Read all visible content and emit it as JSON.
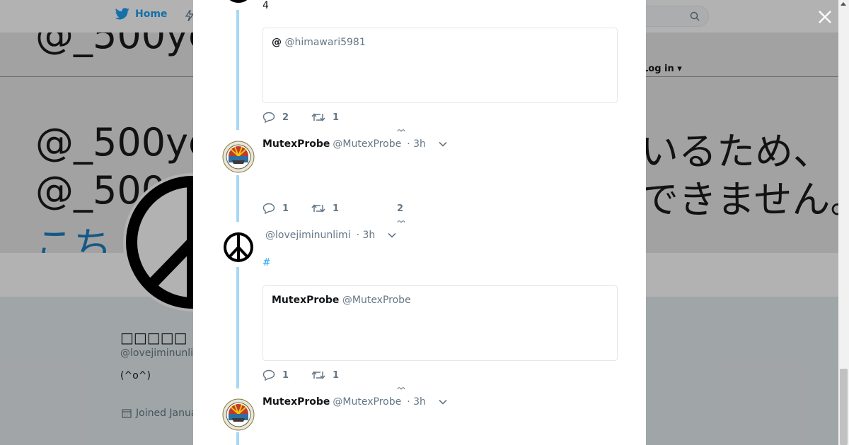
{
  "nav": {
    "home_label": "Home",
    "login_label": "Log in"
  },
  "banner": {
    "line_top": "@_500ye",
    "line1": "@_500ye",
    "line2": "@_500",
    "line3": "こち",
    "right1": "いるため、",
    "right2": "できません。"
  },
  "profile": {
    "name": "□□□□□",
    "handle": "@lovejiminunli",
    "bio": "(^o^)",
    "joined": "Joined Janua"
  },
  "tweets": {
    "t0": {
      "text": "4",
      "quote_at": "@",
      "quote_handle": "@himawari5981",
      "replies": "2",
      "retweets": "1"
    },
    "t1": {
      "name": "MutexProbe",
      "handle": "@MutexProbe",
      "time": "· 3h",
      "replies": "1",
      "retweets": "1",
      "likes": "2"
    },
    "t2": {
      "handle": "@lovejiminunlimi",
      "time": "· 3h",
      "text": "#",
      "quote_name": "MutexProbe",
      "quote_handle": "@MutexProbe",
      "replies": "1",
      "retweets": "1"
    },
    "t3": {
      "name": "MutexProbe",
      "handle": "@MutexProbe",
      "time": "· 3h"
    }
  },
  "colors": {
    "accent": "#1da1f2",
    "thread": "#a6d8f4",
    "muted": "#657786"
  },
  "icons": [
    "twitter-bird-icon",
    "moments-icon",
    "search-icon",
    "close-icon",
    "reply-icon",
    "retweet-icon",
    "chevron-down-icon",
    "calendar-icon",
    "peace-sign-icon"
  ]
}
